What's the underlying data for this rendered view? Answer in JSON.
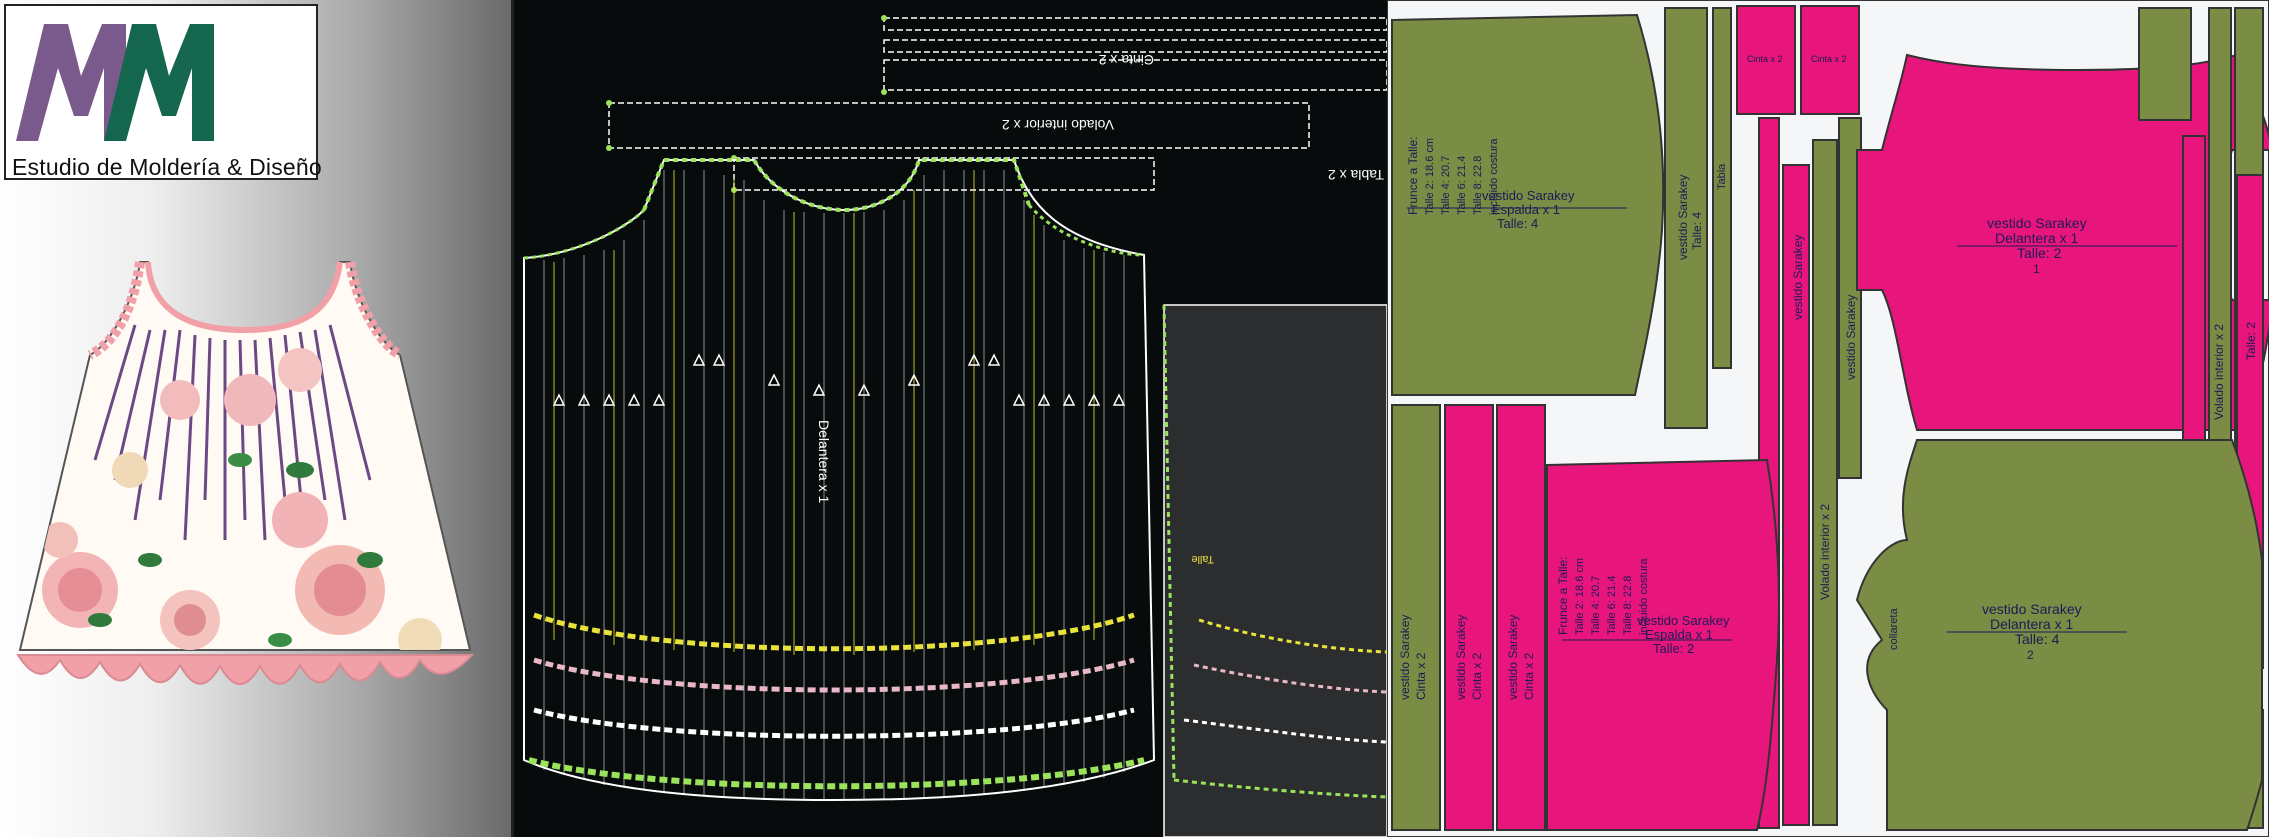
{
  "logo": {
    "letters": "MM",
    "caption": "Estudio de Moldería & Diseño",
    "colors": {
      "m1": "#7a5a8c",
      "m2": "#15664e"
    }
  },
  "colors": {
    "green_piece": "#7b8c45",
    "pink_piece": "#e8167c",
    "ruffle_pink": "#f2a0a8",
    "cad_background": "#070b0b"
  },
  "middle": {
    "label_top": "Cinta x 2",
    "label_volado": "Volado interior x 2",
    "label_right_short": "Tabla x 2",
    "label_front": "Delantera x 1",
    "label_talle": "Talle"
  },
  "right": {
    "pieces": {
      "skirt_green": {
        "title": "vestido Sarakey",
        "subtitle": "Espalda x 1",
        "size": "Talle: 4",
        "frunce_title": "Frunce a Talle:",
        "frunce_lines": [
          "Talle 2: 18.6 cm",
          "Talle 4: 20.7",
          "Talle 6: 21.4",
          "Talle 8: 22.8"
        ],
        "note": "incluido costura"
      },
      "skirt_pink": {
        "title": "vestido Sarakey",
        "subtitle": "Espalda x 1",
        "size": "Talle: 2",
        "frunce_title": "Frunce a Talle:",
        "frunce_lines": [
          "Talle 2: 18.6 cm",
          "Talle 4: 20.7",
          "Talle 6: 21.4",
          "Talle 8: 22.8"
        ],
        "note": "incluido costura"
      },
      "front_pink": {
        "title": "vestido Sarakey",
        "subtitle": "Delantera x 1",
        "size": "Talle: 2",
        "num": "1"
      },
      "front_green": {
        "title": "vestido Sarakey",
        "subtitle": "Delantera x 1",
        "size": "Talle: 4",
        "num": "2"
      },
      "strip_labels": {
        "title": "vestido Sarakey",
        "cinta": "Cinta x 2",
        "volado": "Volado interior x 2",
        "tabla": "Tabla",
        "talle4": "Talle: 4",
        "talle2": "Talle: 2",
        "collareta": "collareta",
        "espalda": "espalda"
      }
    }
  }
}
